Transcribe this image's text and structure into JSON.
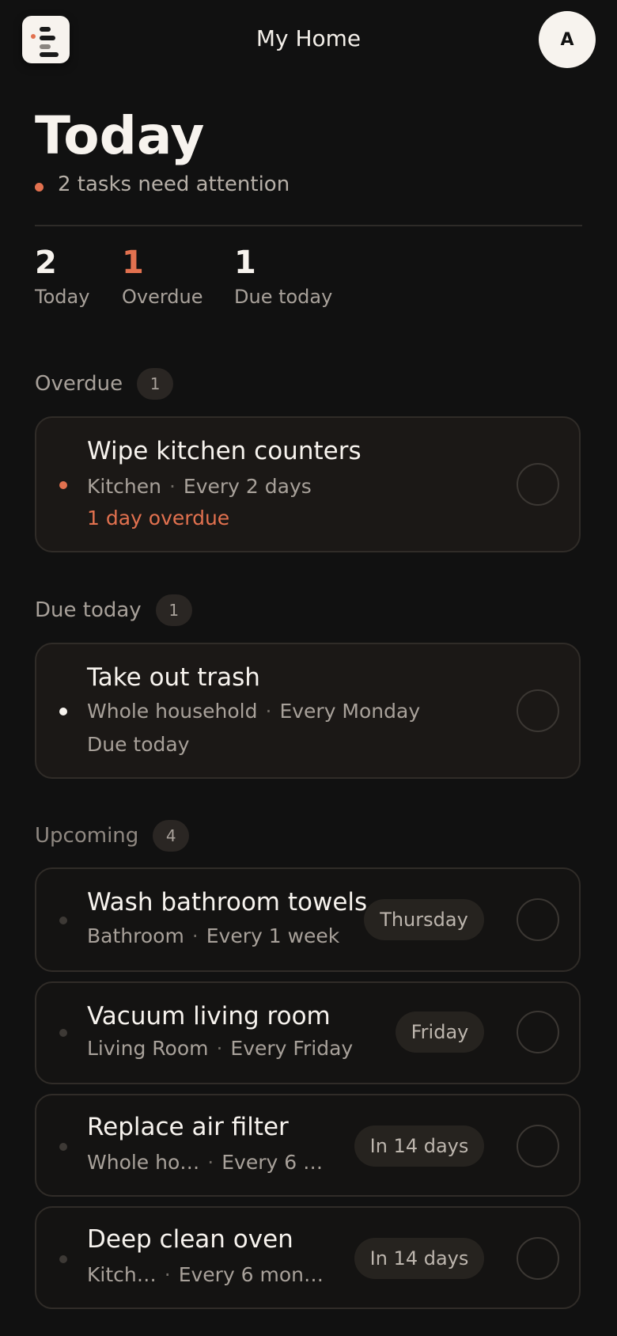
{
  "header": {
    "title": "My Home",
    "avatar_initial": "A"
  },
  "page": {
    "title": "Today",
    "attention": "2 tasks need attention"
  },
  "stats": [
    {
      "value": "2",
      "label": "Today"
    },
    {
      "value": "1",
      "label": "Overdue"
    },
    {
      "value": "1",
      "label": "Due today"
    }
  ],
  "sections": {
    "overdue": {
      "label": "Overdue",
      "count": "1"
    },
    "due_today": {
      "label": "Due today",
      "count": "1"
    },
    "upcoming": {
      "label": "Upcoming",
      "count": "4"
    }
  },
  "tasks": {
    "overdue": [
      {
        "title": "Wipe kitchen counters",
        "room": "Kitchen",
        "sep": "·",
        "frequency": "Every 2 days",
        "status": "1 day overdue"
      }
    ],
    "due_today": [
      {
        "title": "Take out trash",
        "room": "Whole household",
        "sep": "·",
        "frequency": "Every Monday",
        "status": "Due today"
      }
    ],
    "upcoming": [
      {
        "title": "Wash bathroom towels",
        "room": "Bathroom",
        "sep": "·",
        "frequency": "Every 1 week",
        "due": "Thursday"
      },
      {
        "title": "Vacuum living room",
        "room": "Living Room",
        "sep": "·",
        "frequency": "Every Friday",
        "due": "Friday"
      },
      {
        "title": "Replace air filter",
        "room": "Whole ho…",
        "sep": "·",
        "frequency": "Every 6 …",
        "due": "In 14 days"
      },
      {
        "title": "Deep clean oven",
        "room": "Kitch…",
        "sep": "·",
        "frequency": "Every 6 mon…",
        "due": "In 14 days"
      }
    ]
  },
  "colors": {
    "background": "#111111",
    "accent_overdue": "#e2714f",
    "card": "#1b1816",
    "text_muted": "#a8a19a"
  },
  "icons": {
    "logo": "list-logo-icon",
    "status_dot": "status-dot-icon",
    "complete": "circle-check-icon"
  }
}
